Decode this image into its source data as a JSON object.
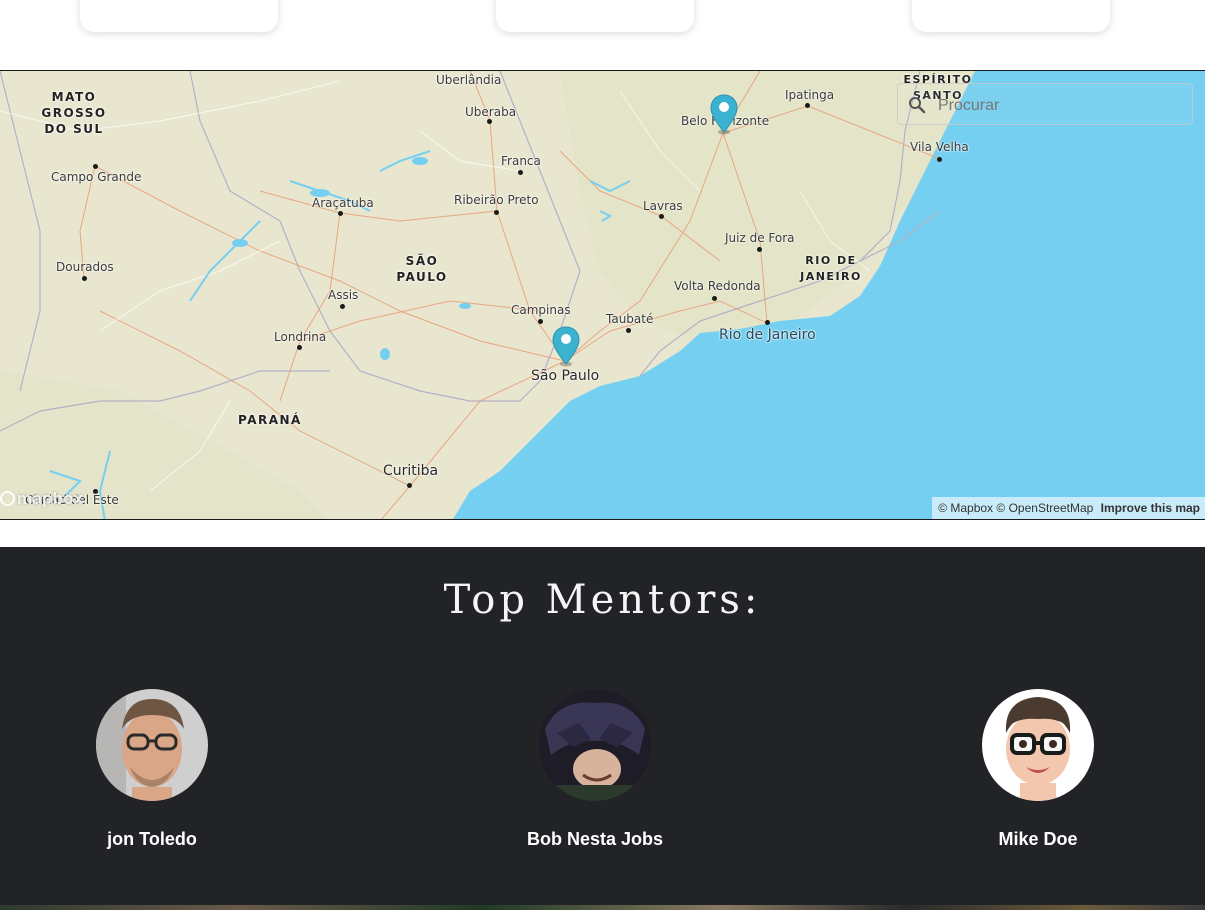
{
  "map": {
    "search_placeholder": "Procurar",
    "attribution": {
      "mapbox": "© Mapbox",
      "osm": "© OpenStreetMap",
      "improve": "Improve this map"
    },
    "logo": "mapbox",
    "states": {
      "ms": "MATO GROSSO DO SUL",
      "sp": "SÃO PAULO",
      "pr": "PARANÁ",
      "rj": "RIO DE JANEIRO",
      "es": "ESPÍRITO SANTO"
    },
    "cities": {
      "uberlandia": "Uberlândia",
      "uberaba": "Uberaba",
      "franca": "Franca",
      "ribeirao": "Ribeirão Preto",
      "aracatuba": "Araçatuba",
      "campo_grande": "Campo Grande",
      "dourados": "Dourados",
      "assis": "Assis",
      "londrina": "Londrina",
      "campinas": "Campinas",
      "sao_paulo": "São Paulo",
      "taubate": "Taubaté",
      "curitiba": "Curitiba",
      "lavras": "Lavras",
      "juiz_de_fora": "Juiz de Fora",
      "volta_redonda": "Volta Redonda",
      "rio": "Rio de Janeiro",
      "belo_horizonte": "Belo Horizonte",
      "ipatinga": "Ipatinga",
      "vila_velha": "Vila Velha",
      "ciudad_del_este": "Ciudad del Este"
    }
  },
  "mentors": {
    "title": "Top Mentors:",
    "items": [
      {
        "name": "jon Toledo"
      },
      {
        "name": "Bob Nesta Jobs"
      },
      {
        "name": "Mike Doe"
      }
    ]
  },
  "colors": {
    "ocean": "#75cff0",
    "land": "#ebe8d1",
    "dark_section": "#212327",
    "marker": "#3bb2d0"
  }
}
